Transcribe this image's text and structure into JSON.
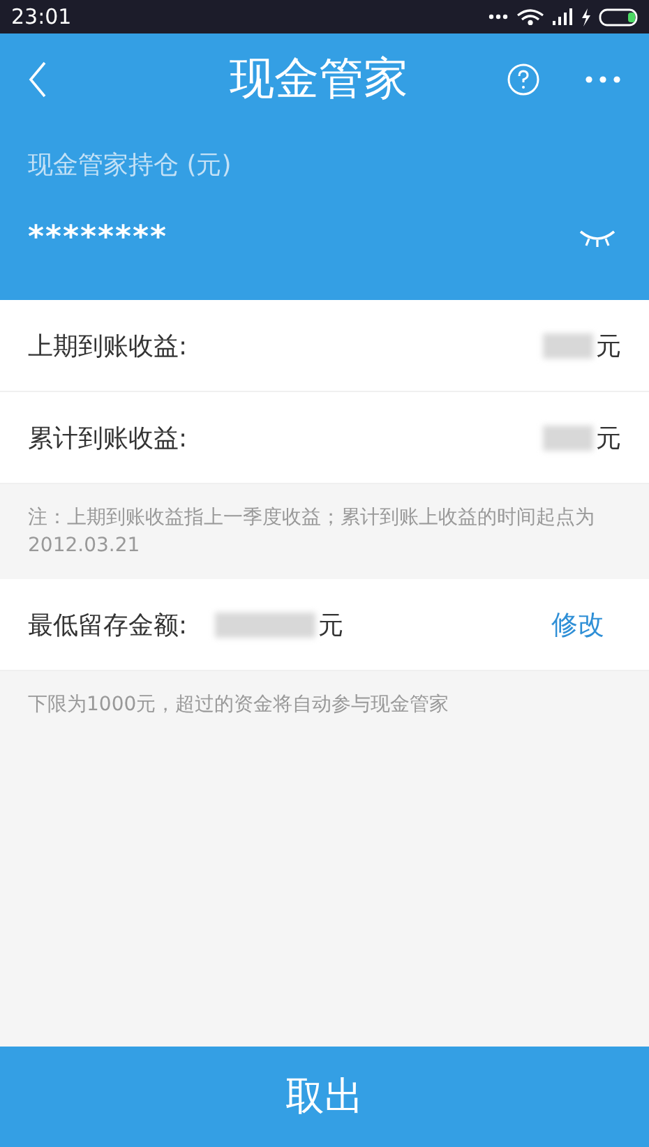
{
  "status_bar": {
    "time": "23:01"
  },
  "header": {
    "title": "现金管家",
    "holding_label": "现金管家持仓 (元)",
    "holding_value": "********",
    "amount_hidden": true
  },
  "earnings": [
    {
      "label": "上期到账收益:",
      "unit": "元"
    },
    {
      "label": "累计到账收益:",
      "unit": "元"
    }
  ],
  "note": "注：上期到账收益指上一季度收益；累计到账上收益的时间起点为2012.03.21",
  "minimum": {
    "label": "最低留存金额:",
    "unit": "元",
    "action": "修改"
  },
  "minimum_note": "下限为1000元，超过的资金将自动参与现金管家",
  "bottom_button": "取出"
}
